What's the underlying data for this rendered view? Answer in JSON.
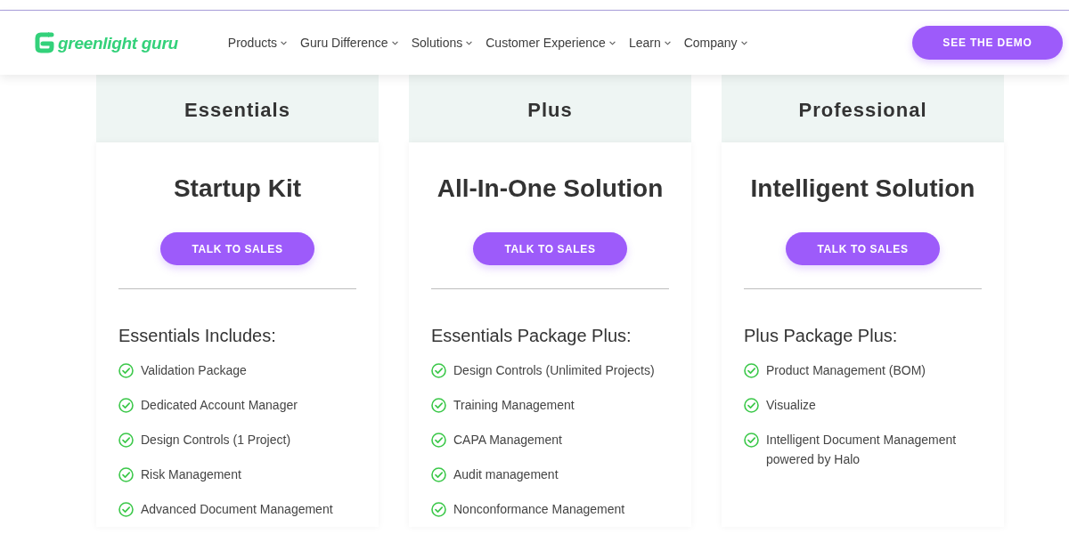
{
  "header": {
    "logo": {
      "text": "greenlight guru"
    },
    "nav": [
      {
        "label": "Products"
      },
      {
        "label": "Guru Difference"
      },
      {
        "label": "Solutions"
      },
      {
        "label": "Customer Experience"
      },
      {
        "label": "Learn"
      },
      {
        "label": "Company"
      }
    ],
    "cta": "SEE THE DEMO"
  },
  "plans": [
    {
      "tier": "Essentials",
      "title": "Startup Kit",
      "button": "TALK TO SALES",
      "features_heading": "Essentials Includes:",
      "features": [
        "Validation Package",
        "Dedicated Account Manager",
        "Design Controls (1 Project)",
        "Risk Management",
        "Advanced Document Management"
      ]
    },
    {
      "tier": "Plus",
      "title": "All-In-One Solution",
      "button": "TALK TO SALES",
      "features_heading": "Essentials Package Plus:",
      "features": [
        "Design Controls (Unlimited Projects)",
        "Training Management",
        "CAPA Management",
        "Audit management",
        "Nonconformance Management"
      ]
    },
    {
      "tier": "Professional",
      "title": "Intelligent Solution",
      "button": "TALK TO SALES",
      "features_heading": "Plus Package Plus:",
      "features": [
        "Product Management (BOM)",
        "Visualize",
        "Intelligent Document Management powered by Halo"
      ]
    }
  ]
}
